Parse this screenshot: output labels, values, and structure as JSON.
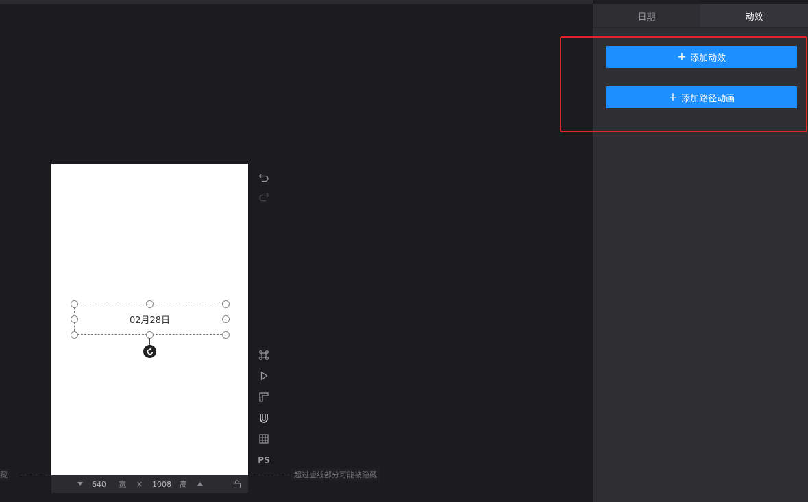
{
  "panel": {
    "tabs": [
      {
        "label": "日期",
        "active": false
      },
      {
        "label": "动效",
        "active": true
      }
    ],
    "add_effect_label": "添加动效",
    "add_path_animation_label": "添加路径动画",
    "plus_symbol": "+"
  },
  "canvas": {
    "text_element": "02月28日",
    "width_value": "640",
    "width_label": "宽",
    "height_value": "1008",
    "height_label": "高",
    "times_symbol": "✕",
    "hint_text": "超过虚线部分可能被隐藏",
    "left_hint_fragment": "藏"
  },
  "tools": {
    "ps_label": "PS"
  },
  "colors": {
    "accent": "#1e8ffe",
    "highlight_border": "#e0262c",
    "panel_bg": "#2e2e33",
    "workspace_bg": "#1c1c1f"
  }
}
